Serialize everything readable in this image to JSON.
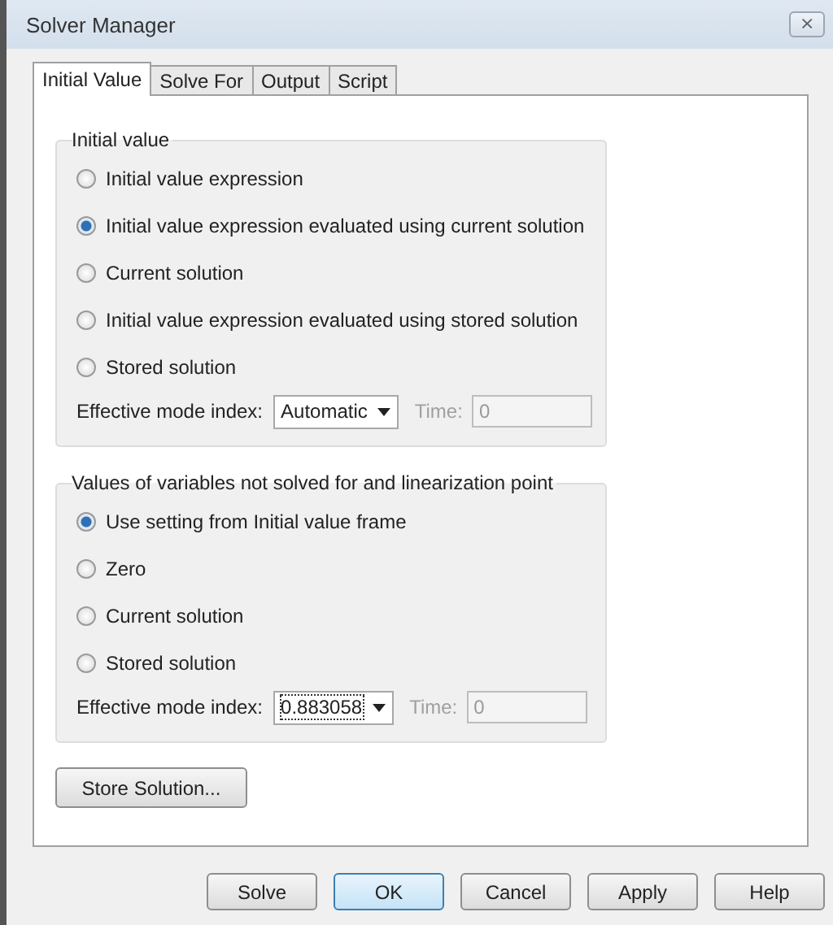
{
  "window": {
    "title": "Solver Manager",
    "close": "⨯"
  },
  "tabs": [
    {
      "label": "Initial Value",
      "selected": true
    },
    {
      "label": "Solve For",
      "selected": false
    },
    {
      "label": "Output",
      "selected": false
    },
    {
      "label": "Script",
      "selected": false
    }
  ],
  "groups": [
    {
      "title": "Initial value",
      "options": [
        {
          "label": "Initial value expression",
          "selected": false
        },
        {
          "label": "Initial value expression evaluated using current solution",
          "selected": true
        },
        {
          "label": "Current solution",
          "selected": false
        },
        {
          "label": "Initial value expression evaluated using stored solution",
          "selected": false
        },
        {
          "label": "Stored solution",
          "selected": false
        }
      ],
      "mode": {
        "label": "Effective mode index:",
        "value": "Automatic",
        "focused": false
      },
      "time": {
        "label": "Time:",
        "value": "0",
        "disabled": true
      }
    },
    {
      "title": "Values of variables not solved for and linearization point",
      "options": [
        {
          "label": "Use setting from Initial value frame",
          "selected": true
        },
        {
          "label": "Zero",
          "selected": false
        },
        {
          "label": "Current solution",
          "selected": false
        },
        {
          "label": "Stored solution",
          "selected": false
        }
      ],
      "mode": {
        "label": "Effective mode index:",
        "value": "0.883058",
        "focused": true
      },
      "time": {
        "label": "Time:",
        "value": "0",
        "disabled": true
      }
    }
  ],
  "store_button": "Store Solution...",
  "buttons": [
    {
      "label": "Solve",
      "default": false
    },
    {
      "label": "OK",
      "default": true
    },
    {
      "label": "Cancel",
      "default": false
    },
    {
      "label": "Apply",
      "default": false
    },
    {
      "label": "Help",
      "default": false
    }
  ]
}
